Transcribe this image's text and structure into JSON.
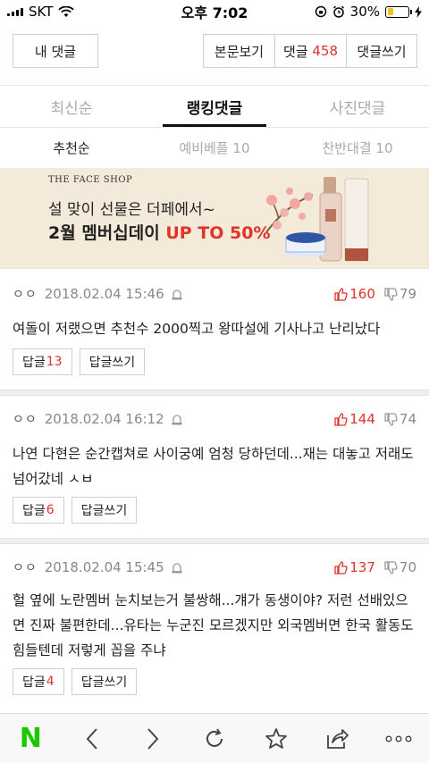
{
  "status_bar": {
    "carrier": "SKT",
    "time": "오후 7:02",
    "battery": "30%",
    "battery_level": 0.3
  },
  "top_buttons": {
    "my_comments": "내 댓글",
    "view_article": "본문보기",
    "comments_label": "댓글",
    "comments_count": "458",
    "write_comment": "댓글쓰기"
  },
  "tabs": [
    {
      "label": "최신순"
    },
    {
      "label": "랭킹댓글"
    },
    {
      "label": "사진댓글"
    }
  ],
  "subtabs": [
    {
      "label": "추천순"
    },
    {
      "label": "예비베플 10"
    },
    {
      "label": "찬반대결 10"
    }
  ],
  "banner": {
    "brand": "THE FACE SHOP",
    "line1": "설 맞이 선물은 더페에서~",
    "line2_prefix": "2월 멤버십데이 ",
    "line2_promo": "UP TO 50%"
  },
  "comments": [
    {
      "user": "ㅇㅇ",
      "date": "2018.02.04 15:46",
      "up": "160",
      "down": "79",
      "body": "여돌이 저랬으면 추천수 2000찍고 왕따설에 기사나고 난리났다",
      "reply_label": "답글",
      "reply_count": "13",
      "write_reply": "답글쓰기"
    },
    {
      "user": "ㅇㅇ",
      "date": "2018.02.04 16:12",
      "up": "144",
      "down": "74",
      "body": "나연 다현은 순간캡쳐로 사이궁예 엄청 당하던데...재는 대놓고 저래도 넘어갔네 ㅅㅂ",
      "reply_label": "답글",
      "reply_count": "6",
      "write_reply": "답글쓰기"
    },
    {
      "user": "ㅇㅇ",
      "date": "2018.02.04 15:45",
      "up": "137",
      "down": "70",
      "body": "헐 옆에 노란멤버 눈치보는거 불쌍해...걔가 동생이야? 저런 선배있으면 진짜 불편한데...유타는 누군진 모르겠지만 외국멤버면 한국 활동도 힘들텐데 저렇게 꼽을 주냐",
      "reply_label": "답글",
      "reply_count": "4",
      "write_reply": "답글쓰기"
    }
  ],
  "bottom_bar": {
    "home_logo": "N"
  },
  "colors": {
    "accent_red": "#e0332a",
    "naver_green": "#1ec800",
    "banner_bg": "#f4ead9"
  }
}
